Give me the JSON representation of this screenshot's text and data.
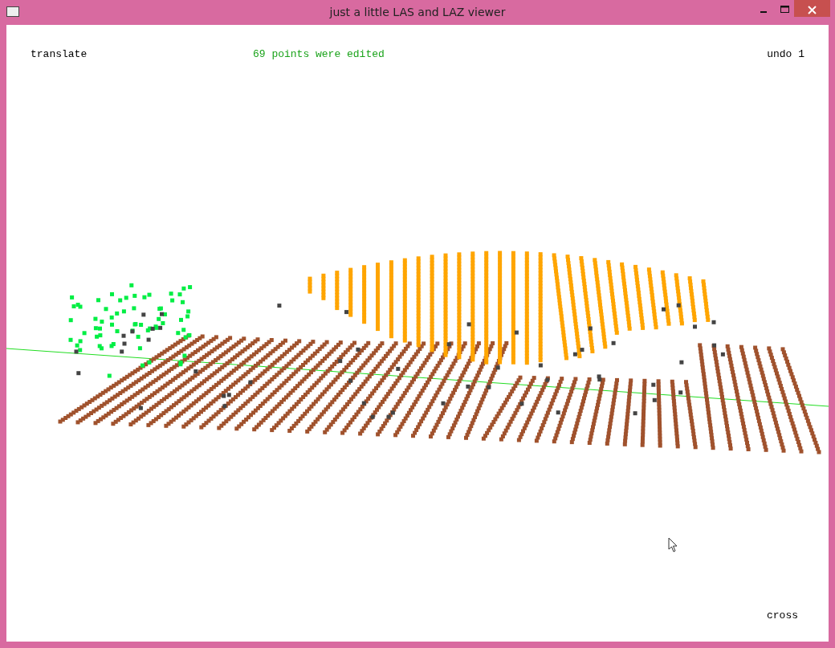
{
  "window": {
    "title": "just a little LAS and LAZ viewer"
  },
  "viewer": {
    "mode": "translate",
    "message": "69 points were edited",
    "undo": "undo 1",
    "cursor_mode": "cross"
  }
}
